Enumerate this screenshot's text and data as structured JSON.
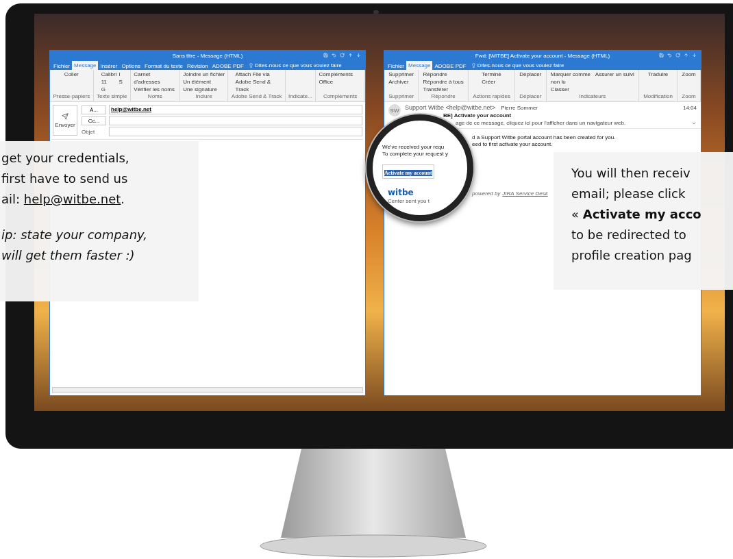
{
  "left_window": {
    "title": "Sans titre - Message (HTML)",
    "tabs": [
      {
        "label": "Fichier",
        "selected": false
      },
      {
        "label": "Message",
        "selected": true
      },
      {
        "label": "Insérer",
        "selected": false
      },
      {
        "label": "Options",
        "selected": false
      },
      {
        "label": "Format du texte",
        "selected": false
      },
      {
        "label": "Révision",
        "selected": false
      },
      {
        "label": "ADOBE PDF",
        "selected": false
      }
    ],
    "tell_me": "Dites-nous ce que vous voulez faire",
    "ribbon": [
      {
        "label": "Presse-papiers",
        "items": [
          "Coller"
        ]
      },
      {
        "label": "Texte simple",
        "items": [
          "Calibri",
          "11",
          "G",
          "I",
          "S"
        ]
      },
      {
        "label": "Noms",
        "items": [
          "Carnet d'adresses",
          "Vérifier les noms"
        ]
      },
      {
        "label": "Inclure",
        "items": [
          "Joindre un fichier",
          "Un élément",
          "Une signature"
        ]
      },
      {
        "label": "Adobe Send & Track",
        "items": [
          "Attach File via Adobe Send & Track"
        ]
      },
      {
        "label": "Indicate..."
      },
      {
        "label": "Compléments",
        "items": [
          "Compléments Office"
        ]
      }
    ],
    "send": "Envoyer",
    "fields": [
      {
        "kind": "button",
        "label": "À...",
        "value": "help@witbe.net"
      },
      {
        "kind": "button",
        "label": "Cc..."
      },
      {
        "kind": "label",
        "label": "Objet"
      }
    ]
  },
  "right_window": {
    "title": "Fwd: [WITBE] Activate your account - Message (HTML)",
    "tabs": [
      {
        "label": "Fichier",
        "selected": false
      },
      {
        "label": "Message",
        "selected": true
      },
      {
        "label": "ADOBE PDF",
        "selected": false
      }
    ],
    "tell_me": "Dites-nous ce que vous voulez faire",
    "ribbon": [
      {
        "label": "Supprimer",
        "items": [
          "Supprimer",
          "Archiver"
        ]
      },
      {
        "label": "Répondre",
        "items": [
          "Répondre",
          "Répondre à tous",
          "Transférer"
        ]
      },
      {
        "label": "Actions rapides",
        "items": [
          "Terminé",
          "Créer"
        ]
      },
      {
        "label": "Déplacer",
        "items": [
          "Déplacer"
        ]
      },
      {
        "label": "Indicateurs",
        "items": [
          "Marquer comme non lu",
          "Classer",
          "Assurer un suivi"
        ]
      },
      {
        "label": "Modification",
        "items": [
          "Traduire"
        ]
      },
      {
        "label": "Zoom",
        "items": [
          "Zoom"
        ]
      }
    ],
    "avatar": "SW",
    "sender": "Support Witbe <help@witbe.net>",
    "recipient": "Pierre Sommer",
    "time": "14:04",
    "subject": "BE] Activate your account",
    "info": "age de ce message, cliquez ici pour l'afficher dans un navigateur web.",
    "body_lines": [
      "d a Support Witbe portal account has been created for you.",
      "eed to first activate your account."
    ],
    "footer": "powered by",
    "footer_link": "JIRA Service Desk"
  },
  "magnifier": {
    "lines": [
      "We've received your requ",
      "To complete your request y"
    ],
    "button": "Activate my account",
    "logo": "witbe",
    "footer": "Center sent you t"
  },
  "left_callout": {
    "lines": [
      "get your credentials,",
      "first have to send us"
    ],
    "lead": "ail: ",
    "link": "help@witbe.net",
    "tail": ".",
    "tip": [
      "ip: state your company,",
      "will get them faster :)"
    ]
  },
  "right_callout": {
    "lines": [
      "You will then receiv",
      "email; please click",
      "« **Activate my acco**",
      "to be redirected to",
      "profile creation pag"
    ]
  }
}
